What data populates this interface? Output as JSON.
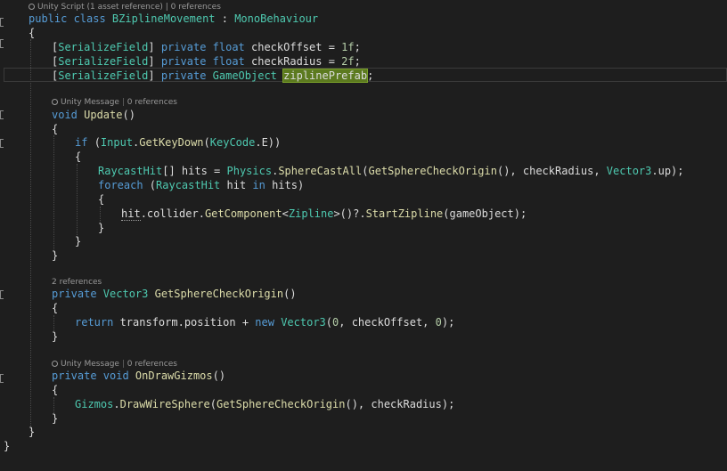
{
  "editor": {
    "lens_class": "Unity Script (1 asset reference) | 0 references",
    "lens_update_a": "Unity Message",
    "lens_update_b": "0 references",
    "lens_origin": "2 references",
    "lens_gizmos_a": "Unity Message",
    "lens_gizmos_b": "0 references",
    "selected_identifier": "ziplinePrefab",
    "lines": {
      "class_decl": {
        "kw": "public class ",
        "name": "BZiplineMovement",
        "colon": " : ",
        "base": "MonoBehaviour"
      },
      "open_class": "{",
      "field1": {
        "attr_open": "[",
        "attr": "SerializeField",
        "attr_close": "]",
        "mods": " private float ",
        "rest": "checkOffset = ",
        "num": "1f",
        "end": ";"
      },
      "field2": {
        "attr_open": "[",
        "attr": "SerializeField",
        "attr_close": "]",
        "mods": " private float ",
        "rest": "checkRadius = ",
        "num": "2f",
        "end": ";"
      },
      "field3": {
        "attr_open": "[",
        "attr": "SerializeField",
        "attr_close": "]",
        "mods": " private ",
        "type": "GameObject",
        "space": " ",
        "name": "ziplinePrefab",
        "end": ";"
      },
      "update_decl": {
        "kw": "void ",
        "name": "Update",
        "rest": "()"
      },
      "open_update": "{",
      "if_line": {
        "kw": "if ",
        "p1": "(",
        "cls": "Input",
        "dot": ".",
        "fn": "GetKeyDown",
        "p2": "(",
        "enm": "KeyCode",
        "rest": ".E))"
      },
      "open_if": "{",
      "hits_line": {
        "type": "RaycastHit",
        "a": "[] hits = ",
        "cls": "Physics",
        "dot": ".",
        "fn": "SphereCastAll",
        "p": "(",
        "fn2": "GetSphereCheckOrigin",
        "b": "(), checkRadius, ",
        "cls2": "Vector3",
        "c": ".up);"
      },
      "foreach_line": {
        "kw": "foreach ",
        "a": "(",
        "type": "RaycastHit",
        "b": " hit ",
        "kw2": "in",
        "c": " hits)"
      },
      "open_foreach": "{",
      "hit_line": {
        "var": "hit",
        "a": ".collider.",
        "fn": "GetComponent",
        "b": "<",
        "type": "Zipline",
        "c": ">()?.",
        "fn2": "StartZipline",
        "d": "(gameObject);"
      },
      "close_foreach": "}",
      "close_if": "}",
      "close_update": "}",
      "origin_decl": {
        "kw": "private ",
        "type": "Vector3",
        "space": " ",
        "name": "GetSphereCheckOrigin",
        "rest": "()"
      },
      "open_origin": "{",
      "return_line": {
        "kw": "return ",
        "a": "transform.position + ",
        "kw2": "new ",
        "type": "Vector3",
        "b": "(",
        "n1": "0",
        "c": ", checkOffset, ",
        "n2": "0",
        "d": ");"
      },
      "close_origin": "}",
      "gizmos_decl": {
        "kw": "private void ",
        "name": "OnDrawGizmos",
        "rest": "()"
      },
      "open_gizmos": "{",
      "gizmos_line": {
        "cls": "Gizmos",
        "dot": ".",
        "fn": "DrawWireSphere",
        "p": "(",
        "fn2": "GetSphereCheckOrigin",
        "rest": "(), checkRadius);"
      },
      "close_gizmos": "}",
      "close_class": "}",
      "close_ns": "}"
    }
  }
}
